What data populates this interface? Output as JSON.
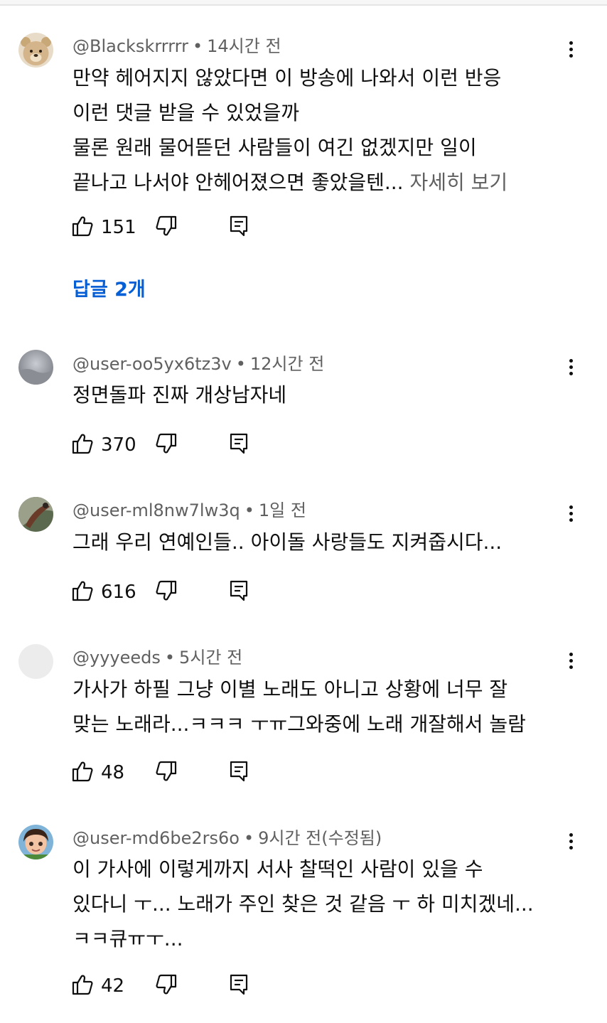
{
  "comments": [
    {
      "author": "@Blackskrrrrr",
      "time": "14시간 전",
      "lines": [
        "만약 헤어지지 않았다면 이 방송에 나와서 이런 반응",
        "이런 댓글 받을 수 있었을까",
        "물론 원래 물어뜯던 사람들이 여긴 없겠지만 일이",
        "끝나고 나서야 안헤어졌으면 좋았을텐..."
      ],
      "read_more": "자세히 보기",
      "likes": "151",
      "replies_label": "답글 2개"
    },
    {
      "author": "@user-oo5yx6tz3v",
      "time": "12시간 전",
      "lines": [
        "정면돌파 진짜 개상남자네"
      ],
      "likes": "370"
    },
    {
      "author": "@user-ml8nw7lw3q",
      "time": "1일 전",
      "lines": [
        "그래 우리 연예인들.. 아이돌 사랑들도 지켜줍시다..."
      ],
      "likes": "616"
    },
    {
      "author": "@yyyeeds",
      "time": "5시간 전",
      "lines": [
        "가사가 하필 그냥 이별 노래도 아니고 상황에 너무 잘",
        "맞는 노래라...ㅋㅋㅋ ㅜㅠ그와중에 노래 개잘해서 놀람"
      ],
      "likes": "48"
    },
    {
      "author": "@user-md6be2rs6o",
      "time": "9시간 전(수정됨)",
      "lines": [
        "이 가사에 이렇게까지 서사 찰떡인 사람이 있을 수",
        "있다니 ㅜ... 노래가 주인 찾은 것 같음 ㅜ 하 미치겠네...",
        "ㅋㅋ큐ㅠㅜ..."
      ],
      "likes": "42"
    }
  ],
  "colors": {
    "text": "#0f0f0f",
    "secondary": "#606060",
    "link": "#065fd4",
    "background": "#ffffff"
  },
  "icons": [
    "thumb-up-icon",
    "thumb-down-icon",
    "reply-icon",
    "more-vert-icon"
  ]
}
